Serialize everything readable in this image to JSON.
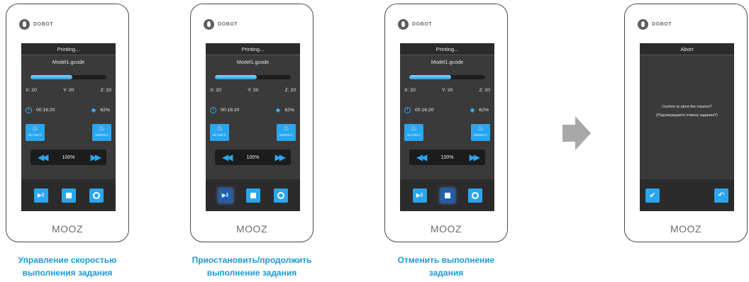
{
  "brand": {
    "logo_text": "DOBOT",
    "device_name": "MOOZ"
  },
  "printing_screen": {
    "title": "Printing...",
    "filename": "Model1.gcode",
    "progress": 0.55,
    "x": "X: 20",
    "y": "Y: 20",
    "z": "Z: 20",
    "time": "00:16:20",
    "percent": "62%",
    "bed_temp": "60 C/60 C",
    "nozzle_temp": "200/200 C",
    "speed": "100%"
  },
  "abort_screen": {
    "title": "Abort",
    "message": "Confirm to abort the mission?",
    "message_ru": "(Подтверждаете отмену задания?)"
  },
  "captions": [
    [
      "Управление скоростью",
      "выполнения задания"
    ],
    [
      "Приостановить/продолжить",
      "выполнение задания"
    ],
    [
      "Отменить выполнение",
      "задания"
    ]
  ],
  "colors": {
    "accent": "#2aa6ef",
    "caption": "#1a9ad9",
    "pressed": "#1e5fae"
  }
}
